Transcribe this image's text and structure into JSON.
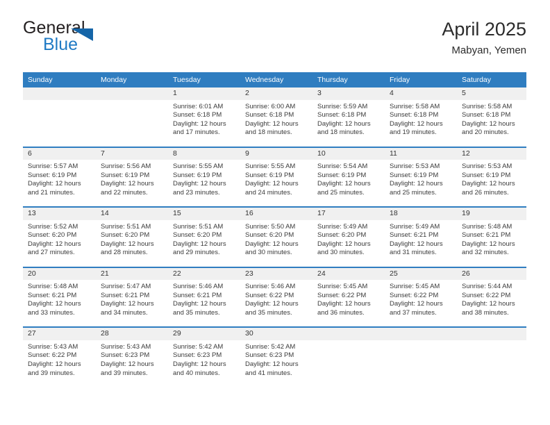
{
  "logo": {
    "word_one": "General",
    "word_two": "Blue",
    "triangle_icon": "triangle-icon",
    "accent_dark": "#1565a8",
    "accent_blue": "#1f7ac4"
  },
  "header": {
    "month_title": "April 2025",
    "location": "Mabyan, Yemen"
  },
  "theme": {
    "header_blue": "#2f7dc0",
    "daynum_grey": "#f0f0f0"
  },
  "calendar": {
    "weekday_headers": [
      "Sunday",
      "Monday",
      "Tuesday",
      "Wednesday",
      "Thursday",
      "Friday",
      "Saturday"
    ],
    "weeks": [
      [
        {
          "day": "",
          "sunrise": "",
          "sunset": "",
          "daylight": ""
        },
        {
          "day": "",
          "sunrise": "",
          "sunset": "",
          "daylight": ""
        },
        {
          "day": "1",
          "sunrise": "Sunrise: 6:01 AM",
          "sunset": "Sunset: 6:18 PM",
          "daylight": "Daylight: 12 hours and 17 minutes."
        },
        {
          "day": "2",
          "sunrise": "Sunrise: 6:00 AM",
          "sunset": "Sunset: 6:18 PM",
          "daylight": "Daylight: 12 hours and 18 minutes."
        },
        {
          "day": "3",
          "sunrise": "Sunrise: 5:59 AM",
          "sunset": "Sunset: 6:18 PM",
          "daylight": "Daylight: 12 hours and 18 minutes."
        },
        {
          "day": "4",
          "sunrise": "Sunrise: 5:58 AM",
          "sunset": "Sunset: 6:18 PM",
          "daylight": "Daylight: 12 hours and 19 minutes."
        },
        {
          "day": "5",
          "sunrise": "Sunrise: 5:58 AM",
          "sunset": "Sunset: 6:18 PM",
          "daylight": "Daylight: 12 hours and 20 minutes."
        }
      ],
      [
        {
          "day": "6",
          "sunrise": "Sunrise: 5:57 AM",
          "sunset": "Sunset: 6:19 PM",
          "daylight": "Daylight: 12 hours and 21 minutes."
        },
        {
          "day": "7",
          "sunrise": "Sunrise: 5:56 AM",
          "sunset": "Sunset: 6:19 PM",
          "daylight": "Daylight: 12 hours and 22 minutes."
        },
        {
          "day": "8",
          "sunrise": "Sunrise: 5:55 AM",
          "sunset": "Sunset: 6:19 PM",
          "daylight": "Daylight: 12 hours and 23 minutes."
        },
        {
          "day": "9",
          "sunrise": "Sunrise: 5:55 AM",
          "sunset": "Sunset: 6:19 PM",
          "daylight": "Daylight: 12 hours and 24 minutes."
        },
        {
          "day": "10",
          "sunrise": "Sunrise: 5:54 AM",
          "sunset": "Sunset: 6:19 PM",
          "daylight": "Daylight: 12 hours and 25 minutes."
        },
        {
          "day": "11",
          "sunrise": "Sunrise: 5:53 AM",
          "sunset": "Sunset: 6:19 PM",
          "daylight": "Daylight: 12 hours and 25 minutes."
        },
        {
          "day": "12",
          "sunrise": "Sunrise: 5:53 AM",
          "sunset": "Sunset: 6:19 PM",
          "daylight": "Daylight: 12 hours and 26 minutes."
        }
      ],
      [
        {
          "day": "13",
          "sunrise": "Sunrise: 5:52 AM",
          "sunset": "Sunset: 6:20 PM",
          "daylight": "Daylight: 12 hours and 27 minutes."
        },
        {
          "day": "14",
          "sunrise": "Sunrise: 5:51 AM",
          "sunset": "Sunset: 6:20 PM",
          "daylight": "Daylight: 12 hours and 28 minutes."
        },
        {
          "day": "15",
          "sunrise": "Sunrise: 5:51 AM",
          "sunset": "Sunset: 6:20 PM",
          "daylight": "Daylight: 12 hours and 29 minutes."
        },
        {
          "day": "16",
          "sunrise": "Sunrise: 5:50 AM",
          "sunset": "Sunset: 6:20 PM",
          "daylight": "Daylight: 12 hours and 30 minutes."
        },
        {
          "day": "17",
          "sunrise": "Sunrise: 5:49 AM",
          "sunset": "Sunset: 6:20 PM",
          "daylight": "Daylight: 12 hours and 30 minutes."
        },
        {
          "day": "18",
          "sunrise": "Sunrise: 5:49 AM",
          "sunset": "Sunset: 6:21 PM",
          "daylight": "Daylight: 12 hours and 31 minutes."
        },
        {
          "day": "19",
          "sunrise": "Sunrise: 5:48 AM",
          "sunset": "Sunset: 6:21 PM",
          "daylight": "Daylight: 12 hours and 32 minutes."
        }
      ],
      [
        {
          "day": "20",
          "sunrise": "Sunrise: 5:48 AM",
          "sunset": "Sunset: 6:21 PM",
          "daylight": "Daylight: 12 hours and 33 minutes."
        },
        {
          "day": "21",
          "sunrise": "Sunrise: 5:47 AM",
          "sunset": "Sunset: 6:21 PM",
          "daylight": "Daylight: 12 hours and 34 minutes."
        },
        {
          "day": "22",
          "sunrise": "Sunrise: 5:46 AM",
          "sunset": "Sunset: 6:21 PM",
          "daylight": "Daylight: 12 hours and 35 minutes."
        },
        {
          "day": "23",
          "sunrise": "Sunrise: 5:46 AM",
          "sunset": "Sunset: 6:22 PM",
          "daylight": "Daylight: 12 hours and 35 minutes."
        },
        {
          "day": "24",
          "sunrise": "Sunrise: 5:45 AM",
          "sunset": "Sunset: 6:22 PM",
          "daylight": "Daylight: 12 hours and 36 minutes."
        },
        {
          "day": "25",
          "sunrise": "Sunrise: 5:45 AM",
          "sunset": "Sunset: 6:22 PM",
          "daylight": "Daylight: 12 hours and 37 minutes."
        },
        {
          "day": "26",
          "sunrise": "Sunrise: 5:44 AM",
          "sunset": "Sunset: 6:22 PM",
          "daylight": "Daylight: 12 hours and 38 minutes."
        }
      ],
      [
        {
          "day": "27",
          "sunrise": "Sunrise: 5:43 AM",
          "sunset": "Sunset: 6:22 PM",
          "daylight": "Daylight: 12 hours and 39 minutes."
        },
        {
          "day": "28",
          "sunrise": "Sunrise: 5:43 AM",
          "sunset": "Sunset: 6:23 PM",
          "daylight": "Daylight: 12 hours and 39 minutes."
        },
        {
          "day": "29",
          "sunrise": "Sunrise: 5:42 AM",
          "sunset": "Sunset: 6:23 PM",
          "daylight": "Daylight: 12 hours and 40 minutes."
        },
        {
          "day": "30",
          "sunrise": "Sunrise: 5:42 AM",
          "sunset": "Sunset: 6:23 PM",
          "daylight": "Daylight: 12 hours and 41 minutes."
        },
        {
          "day": "",
          "sunrise": "",
          "sunset": "",
          "daylight": ""
        },
        {
          "day": "",
          "sunrise": "",
          "sunset": "",
          "daylight": ""
        },
        {
          "day": "",
          "sunrise": "",
          "sunset": "",
          "daylight": ""
        }
      ]
    ]
  }
}
